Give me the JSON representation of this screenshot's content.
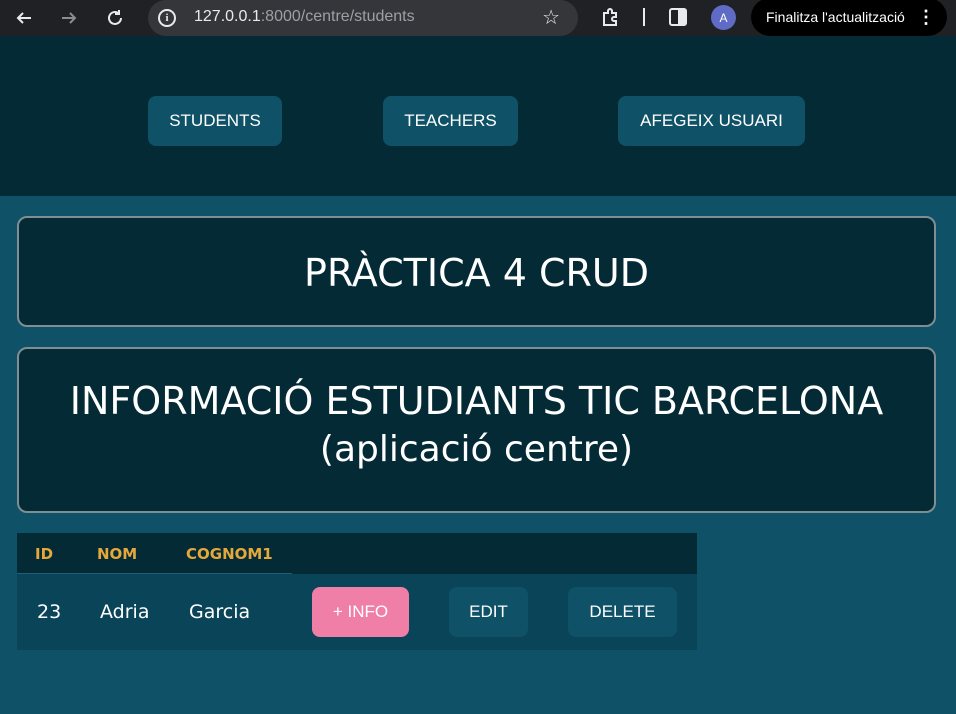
{
  "browser": {
    "url_host": "127.0.0.1",
    "url_port": ":8000",
    "url_path": "/centre/students",
    "profile_initial": "A",
    "update_label": "Finalitza l'actualització"
  },
  "nav": {
    "items": [
      {
        "label": "STUDENTS"
      },
      {
        "label": "TEACHERS"
      },
      {
        "label": "AFEGEIX USUARI"
      }
    ]
  },
  "header": {
    "title": "PRÀCTICA 4 CRUD",
    "subtitle_line1": "INFORMACIÓ ESTUDIANTS TIC BARCELONA",
    "subtitle_line2": "(aplicació centre)"
  },
  "table": {
    "columns": [
      "ID",
      "NOM",
      "COGNOM1"
    ],
    "rows": [
      {
        "id": "23",
        "nom": "Adria",
        "cognom1": "Garcia"
      }
    ],
    "actions": {
      "info": "+ INFO",
      "edit": "EDIT",
      "delete": "DELETE"
    }
  },
  "colors": {
    "page_bg": "#0f5166",
    "panel_bg": "#042a36",
    "header_text": "#e4a93a",
    "info_button": "#f07fa8"
  }
}
